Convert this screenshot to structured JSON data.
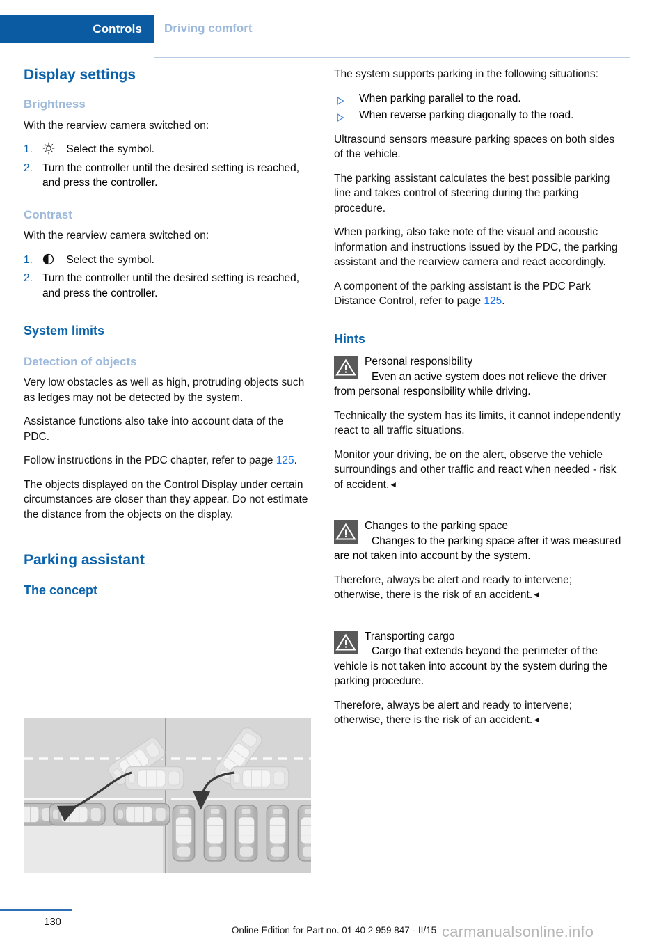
{
  "header": {
    "tab_label": "Controls",
    "section_label": "Driving comfort",
    "accent_color": "#0b5ba3",
    "muted_color": "#9db9dc"
  },
  "left_column": {
    "display_settings_heading": "Display settings",
    "brightness": {
      "heading": "Brightness",
      "intro": "With the rearview camera switched on:",
      "steps": [
        {
          "num": "1.",
          "icon": "brightness-sun-icon",
          "text": "Select the symbol."
        },
        {
          "num": "2.",
          "icon": "",
          "text": "Turn the controller until the desired setting is reached, and press the controller."
        }
      ]
    },
    "contrast": {
      "heading": "Contrast",
      "intro": "With the rearview camera switched on:",
      "steps": [
        {
          "num": "1.",
          "icon": "contrast-half-circle-icon",
          "text": "Select the symbol."
        },
        {
          "num": "2.",
          "icon": "",
          "text": "Turn the controller until the desired setting is reached, and press the controller."
        }
      ]
    },
    "system_limits_heading": "System limits",
    "detection": {
      "heading": "Detection of objects",
      "p1": "Very low obstacles as well as high, protruding objects such as ledges may not be detected by the system.",
      "p2": "Assistance functions also take into account data of the PDC.",
      "p3_before": "Follow instructions in the PDC chapter, refer to page ",
      "p3_pageref": "125",
      "p3_after": ".",
      "p4": "The objects displayed on the Control Display under certain circumstances are closer than they appear. Do not estimate the distance from the objects on the display."
    },
    "parking_assistant_heading": "Parking assistant",
    "the_concept_heading": "The concept",
    "figure": {
      "name": "parking-assistant-concept-diagram",
      "left_scene": "parallel parking maneuver into a kerbside gap",
      "right_scene": "reverse diagonal parking into a bay"
    }
  },
  "right_column": {
    "intro": "The system supports parking in the following situations:",
    "bullets": [
      "When parking parallel to the road.",
      "When reverse parking diagonally to the road."
    ],
    "p1": "Ultrasound sensors measure parking spaces on both sides of the vehicle.",
    "p2": "The parking assistant calculates the best pos­sible parking line and takes control of steering during the parking procedure.",
    "p3": "When parking, also take note of the visual and acoustic information and instructions issued by the PDC, the parking assistant and the rear­view camera and react accordingly.",
    "p4_before": "A component of the parking assistant is the PDC Park Distance Control, refer to page ",
    "p4_pageref": "125",
    "p4_after": ".",
    "hints_heading": "Hints",
    "warnings": [
      {
        "icon": "warning-triangle-icon",
        "title": "Personal responsibility",
        "lead": "Even an active system does not relieve the driver from personal responsibility while driving.",
        "paras": [
          "Technically the system has its limits, it cannot independently react to all traffic situations.",
          "Monitor your driving, be on the alert, observe the vehicle surroundings and other traffic and react when needed - risk of accident."
        ],
        "end_mark": "◄"
      },
      {
        "icon": "warning-triangle-icon",
        "title": "Changes to the parking space",
        "lead": "Changes to the parking space after it was measured are not taken into account by the system.",
        "paras": [
          "Therefore, always be alert and ready to inter­vene; otherwise, there is the risk of an acci­dent."
        ],
        "end_mark": "◄"
      },
      {
        "icon": "warning-triangle-icon",
        "title": "Transporting cargo",
        "lead": "Cargo that extends beyond the perimeter of the vehicle is not taken into account by the system during the parking procedure.",
        "paras": [
          "Therefore, always be alert and ready to inter­vene; otherwise, there is the risk of an acci­dent."
        ],
        "end_mark": "◄"
      }
    ]
  },
  "footer": {
    "page_number": "130",
    "edition_text": "Online Edition for Part no. 01 40 2 959 847 - II/15",
    "watermark": "carmanualsonline.info"
  }
}
